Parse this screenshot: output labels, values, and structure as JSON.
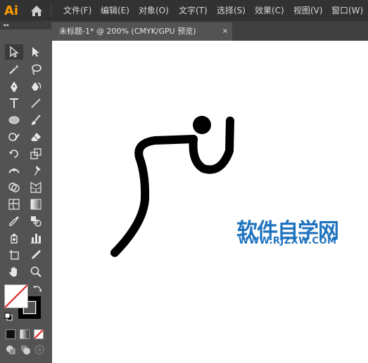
{
  "app": {
    "logo": "Ai",
    "home_icon": "home-icon"
  },
  "menu": [
    {
      "label": "文件(F)"
    },
    {
      "label": "编辑(E)"
    },
    {
      "label": "对象(O)"
    },
    {
      "label": "文字(T)"
    },
    {
      "label": "选择(S)"
    },
    {
      "label": "效果(C)"
    },
    {
      "label": "视图(V)"
    },
    {
      "label": "窗口(W)"
    }
  ],
  "panel": {
    "collapse": "◂◂"
  },
  "tools": [
    "selection-tool-icon",
    "direct-selection-tool-icon",
    "magic-wand-tool-icon",
    "lasso-tool-icon",
    "pen-tool-icon",
    "curvature-tool-icon",
    "type-tool-icon",
    "line-segment-tool-icon",
    "ellipse-tool-icon",
    "paintbrush-tool-icon",
    "shaper-tool-icon",
    "eraser-tool-icon",
    "rotate-tool-icon",
    "scale-tool-icon",
    "width-tool-icon",
    "puppet-warp-tool-icon",
    "shape-builder-tool-icon",
    "perspective-grid-tool-icon",
    "mesh-tool-icon",
    "gradient-tool-icon",
    "eyedropper-tool-icon",
    "blend-tool-icon",
    "symbol-sprayer-tool-icon",
    "column-graph-tool-icon",
    "artboard-tool-icon",
    "slice-tool-icon",
    "hand-tool-icon",
    "zoom-tool-icon"
  ],
  "document": {
    "tab_title": "未标题-1* @ 200% (CMYK/GPU 预览)",
    "close": "×"
  },
  "colors": {
    "stroke": "#000000",
    "fill_none_slash": "#e02020",
    "watermark": "#1e72bf",
    "menubar_bg": "#323232",
    "panel_bg": "#535353"
  },
  "watermark": {
    "title": "软件自学网",
    "url": "WWW.RJZXW.COM"
  }
}
